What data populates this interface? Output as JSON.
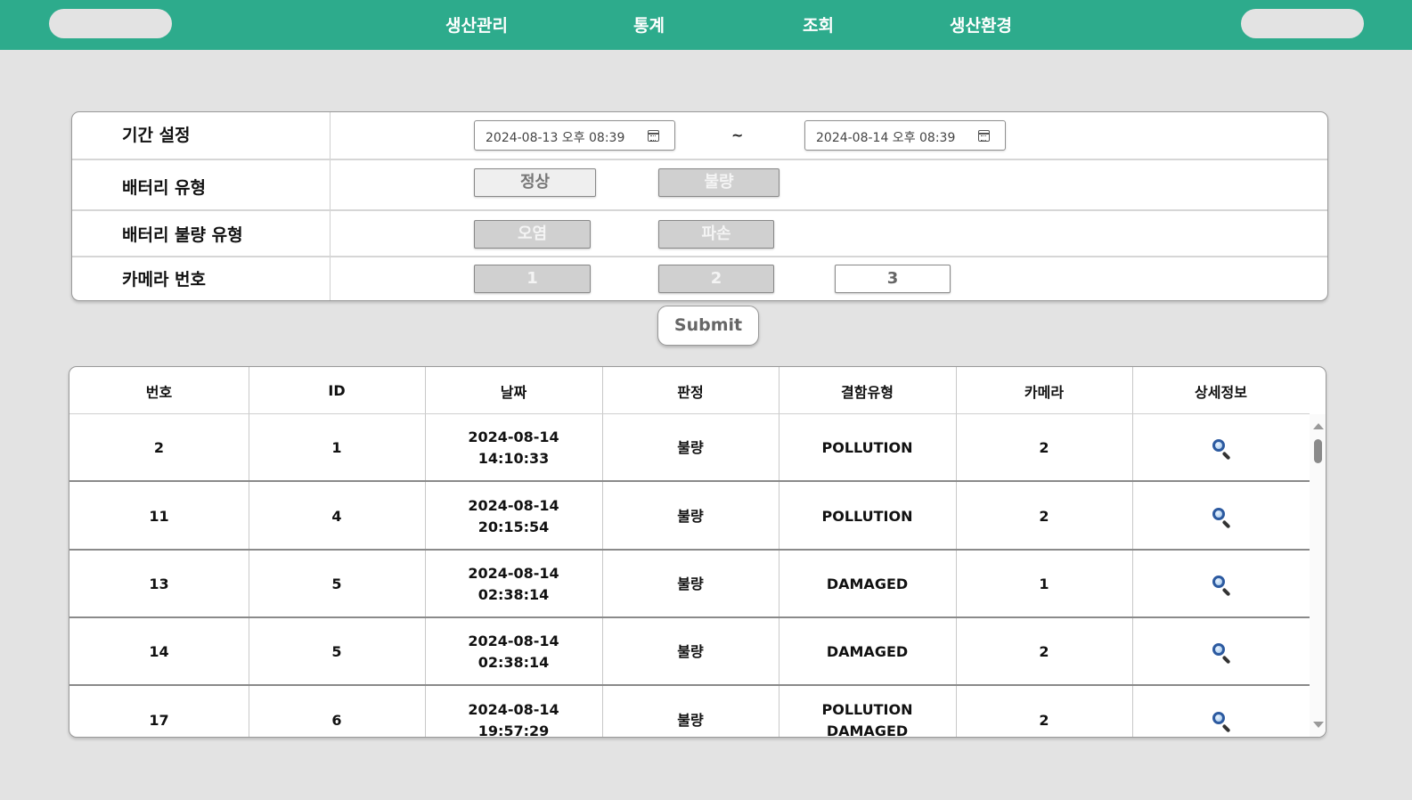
{
  "nav": {
    "items": [
      "생산관리",
      "통계",
      "조회",
      "생산환경"
    ]
  },
  "filter": {
    "period_label": "기간 설정",
    "date_from": "2024-08-13 오후 08:39",
    "date_to": "2024-08-14 오후 08:39",
    "tilde": "~",
    "battery_type_label": "배터리 유형",
    "battery_type_options": [
      "정상",
      "불량"
    ],
    "defect_type_label": "배터리 불량 유형",
    "defect_type_options": [
      "오염",
      "파손"
    ],
    "camera_label": "카메라 번호",
    "camera_options": [
      "1",
      "2",
      "3"
    ]
  },
  "submit_label": "Submit",
  "table": {
    "headers": [
      "번호",
      "ID",
      "날짜",
      "판정",
      "결함유형",
      "카메라",
      "상세정보"
    ],
    "rows": [
      {
        "no": "2",
        "id": "1",
        "date": "2024-08-14",
        "time": "14:10:33",
        "judge": "불량",
        "defect": "POLLUTION",
        "defect2": "",
        "camera": "2"
      },
      {
        "no": "11",
        "id": "4",
        "date": "2024-08-14",
        "time": "20:15:54",
        "judge": "불량",
        "defect": "POLLUTION",
        "defect2": "",
        "camera": "2"
      },
      {
        "no": "13",
        "id": "5",
        "date": "2024-08-14",
        "time": "02:38:14",
        "judge": "불량",
        "defect": "DAMAGED",
        "defect2": "",
        "camera": "1"
      },
      {
        "no": "14",
        "id": "5",
        "date": "2024-08-14",
        "time": "02:38:14",
        "judge": "불량",
        "defect": "DAMAGED",
        "defect2": "",
        "camera": "2"
      },
      {
        "no": "17",
        "id": "6",
        "date": "2024-08-14",
        "time": "19:57:29",
        "judge": "불량",
        "defect": "POLLUTION",
        "defect2": "DAMAGED",
        "camera": "2"
      }
    ],
    "detail_icon": "magnifier-icon"
  },
  "colors": {
    "header": "#2dab8c",
    "background": "#e3e3e3"
  }
}
